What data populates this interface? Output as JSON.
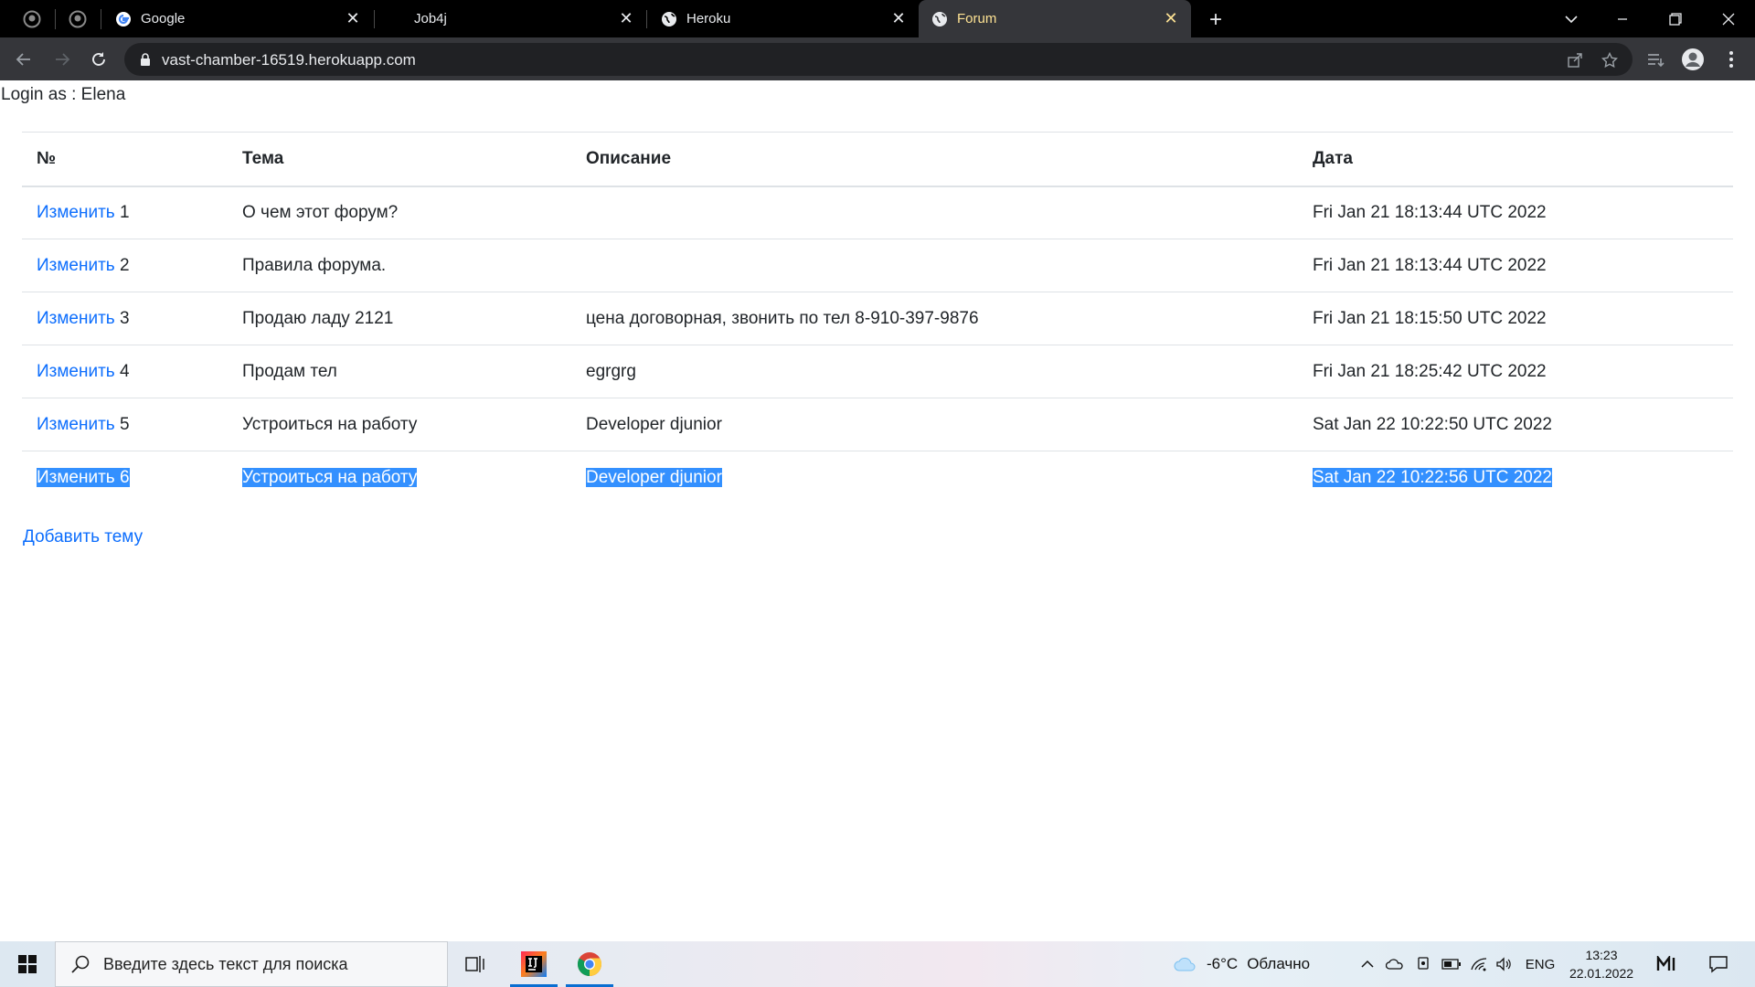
{
  "browser": {
    "tabs": [
      {
        "title": "Google",
        "icon": "google-icon"
      },
      {
        "title": "Job4j",
        "icon": "job4j-icon"
      },
      {
        "title": "Heroku",
        "icon": "globe-icon"
      },
      {
        "title": "Forum",
        "icon": "globe-icon",
        "active": true
      }
    ],
    "url": "vast-chamber-16519.herokuapp.com",
    "accent": "#fde293"
  },
  "page": {
    "login_text": "Login as : Elena",
    "columns": [
      "№",
      "Тема",
      "Описание",
      "Дата"
    ],
    "edit_label": "Изменить",
    "rows": [
      {
        "num": "1",
        "topic": "О чем этот форум?",
        "desc": "",
        "date": "Fri Jan 21 18:13:44 UTC 2022",
        "selected": false
      },
      {
        "num": "2",
        "topic": "Правила форума.",
        "desc": "",
        "date": "Fri Jan 21 18:13:44 UTC 2022",
        "selected": false
      },
      {
        "num": "3",
        "topic": "Продаю ладу 2121",
        "desc": "цена договорная, звонить по тел 8-910-397-9876",
        "date": "Fri Jan 21 18:15:50 UTC 2022",
        "selected": false
      },
      {
        "num": "4",
        "topic": "Продам тел",
        "desc": "egrgrg",
        "date": "Fri Jan 21 18:25:42 UTC 2022",
        "selected": false
      },
      {
        "num": "5",
        "topic": "Устроиться на работу",
        "desc": "Developer djunior",
        "date": "Sat Jan 22 10:22:50 UTC 2022",
        "selected": false
      },
      {
        "num": "6",
        "topic": "Устроиться на работу",
        "desc": "Developer djunior",
        "date": "Sat Jan 22 10:22:56 UTC 2022",
        "selected": true
      }
    ],
    "add_topic_label": "Добавить тему",
    "link_color": "#0d6efd",
    "selection_color": "#3390ff"
  },
  "taskbar": {
    "search_placeholder": "Введите здесь текст для поиска",
    "weather_temp": "-6°C",
    "weather_text": "Облачно",
    "language": "ENG",
    "time": "13:23",
    "date": "22.01.2022"
  }
}
